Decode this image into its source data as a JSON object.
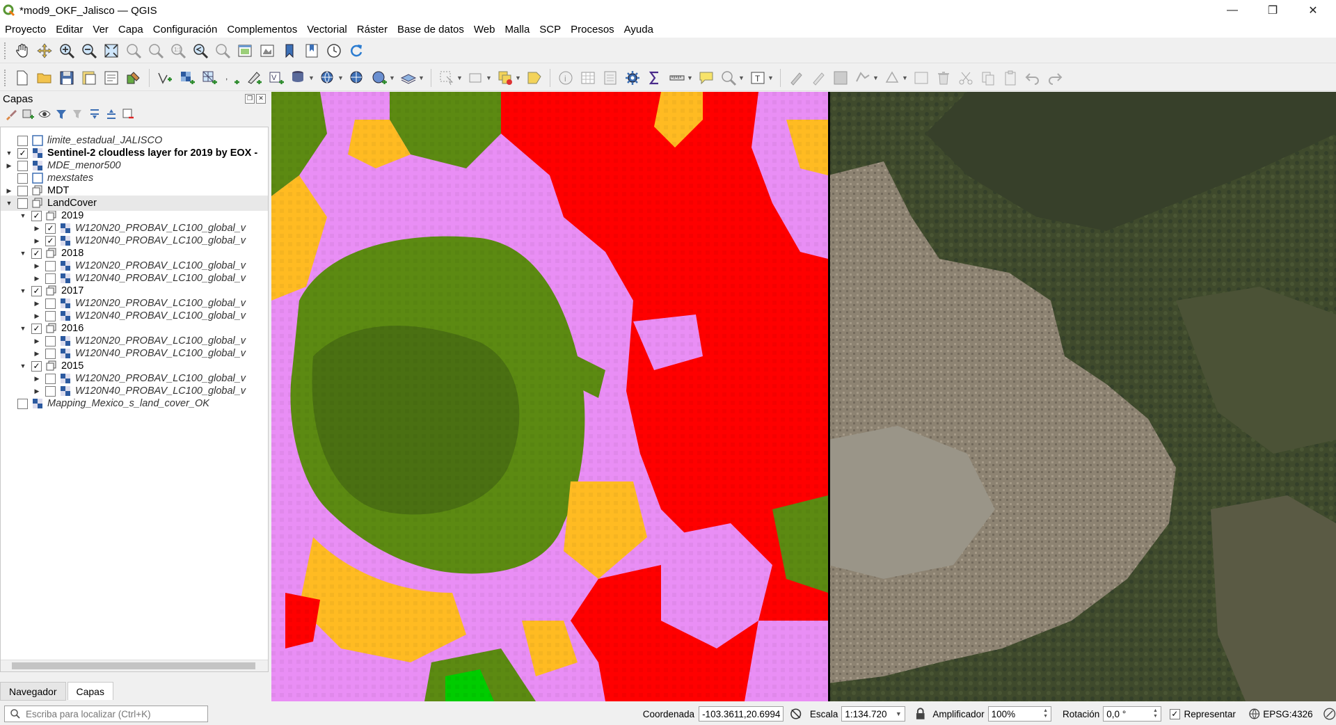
{
  "window": {
    "title": "*mod9_OKF_Jalisco — QGIS",
    "minimize": "—",
    "restore": "❐",
    "close": "✕"
  },
  "menu": [
    "Proyecto",
    "Editar",
    "Ver",
    "Capa",
    "Configuración",
    "Complementos",
    "Vectorial",
    "Ráster",
    "Base de datos",
    "Web",
    "Malla",
    "SCP",
    "Procesos",
    "Ayuda"
  ],
  "layers_panel": {
    "title": "Capas",
    "layers": [
      {
        "name": "limite_estadual_JALISCO",
        "checked": false,
        "style": "italic",
        "indent": 0,
        "expander": "",
        "icon": "vector"
      },
      {
        "name": "Sentinel-2 cloudless layer for 2019 by EOX -",
        "checked": true,
        "style": "bold",
        "indent": 0,
        "expander": "▼",
        "icon": "raster"
      },
      {
        "name": "MDE_menor500",
        "checked": false,
        "style": "italic",
        "indent": 0,
        "expander": "▶",
        "icon": "raster"
      },
      {
        "name": "mexstates",
        "checked": false,
        "style": "italic",
        "indent": 0,
        "expander": "",
        "icon": "vector"
      },
      {
        "name": "MDT",
        "checked": false,
        "style": "normal",
        "indent": 0,
        "expander": "▶",
        "icon": "group"
      },
      {
        "name": "LandCover",
        "checked": false,
        "style": "normal",
        "indent": 0,
        "expander": "▼",
        "icon": "group",
        "selected": true
      },
      {
        "name": "2019",
        "checked": true,
        "style": "normal",
        "indent": 1,
        "expander": "▼",
        "icon": "group"
      },
      {
        "name": "W120N20_PROBAV_LC100_global_v",
        "checked": true,
        "style": "italic",
        "indent": 2,
        "expander": "▶",
        "icon": "raster"
      },
      {
        "name": "W120N40_PROBAV_LC100_global_v",
        "checked": true,
        "style": "italic",
        "indent": 2,
        "expander": "▶",
        "icon": "raster"
      },
      {
        "name": "2018",
        "checked": true,
        "style": "normal",
        "indent": 1,
        "expander": "▼",
        "icon": "group"
      },
      {
        "name": "W120N20_PROBAV_LC100_global_v",
        "checked": false,
        "style": "italic",
        "indent": 2,
        "expander": "▶",
        "icon": "raster"
      },
      {
        "name": "W120N40_PROBAV_LC100_global_v",
        "checked": false,
        "style": "italic",
        "indent": 2,
        "expander": "▶",
        "icon": "raster"
      },
      {
        "name": "2017",
        "checked": true,
        "style": "normal",
        "indent": 1,
        "expander": "▼",
        "icon": "group"
      },
      {
        "name": "W120N20_PROBAV_LC100_global_v",
        "checked": false,
        "style": "italic",
        "indent": 2,
        "expander": "▶",
        "icon": "raster"
      },
      {
        "name": "W120N40_PROBAV_LC100_global_v",
        "checked": false,
        "style": "italic",
        "indent": 2,
        "expander": "▶",
        "icon": "raster"
      },
      {
        "name": "2016",
        "checked": true,
        "style": "normal",
        "indent": 1,
        "expander": "▼",
        "icon": "group"
      },
      {
        "name": "W120N20_PROBAV_LC100_global_v",
        "checked": false,
        "style": "italic",
        "indent": 2,
        "expander": "▶",
        "icon": "raster"
      },
      {
        "name": "W120N40_PROBAV_LC100_global_v",
        "checked": false,
        "style": "italic",
        "indent": 2,
        "expander": "▶",
        "icon": "raster"
      },
      {
        "name": "2015",
        "checked": true,
        "style": "normal",
        "indent": 1,
        "expander": "▼",
        "icon": "group"
      },
      {
        "name": "W120N20_PROBAV_LC100_global_v",
        "checked": false,
        "style": "italic",
        "indent": 2,
        "expander": "▶",
        "icon": "raster"
      },
      {
        "name": "W120N40_PROBAV_LC100_global_v",
        "checked": false,
        "style": "italic",
        "indent": 2,
        "expander": "▶",
        "icon": "raster"
      },
      {
        "name": "Mapping_Mexico_s_land_cover_OK",
        "checked": false,
        "style": "italic",
        "indent": 0,
        "expander": "",
        "icon": "raster"
      }
    ]
  },
  "tabs": [
    "Navegador",
    "Capas"
  ],
  "active_tab": "Capas",
  "statusbar": {
    "locator_placeholder": "Escriba para localizar (Ctrl+K)",
    "coord_label": "Coordenada",
    "coord_value": "-103.3611,20.6994",
    "scale_label": "Escala",
    "scale_value": "1:134.720",
    "magnifier_label": "Amplificador",
    "magnifier_value": "100%",
    "rotation_label": "Rotación",
    "rotation_value": "0,0 °",
    "render_label": "Representar",
    "crs": "EPSG:4326"
  },
  "colors": {
    "landcover_pink": "#e98ef5",
    "landcover_red": "#ff0000",
    "landcover_yellow": "#ffbb22",
    "landcover_olive": "#5c8a12",
    "landcover_darkolive": "#4a7012",
    "landcover_green": "#00cc00",
    "satellite_dark": "#3a3f2a",
    "satellite_urban": "#8a8070"
  }
}
